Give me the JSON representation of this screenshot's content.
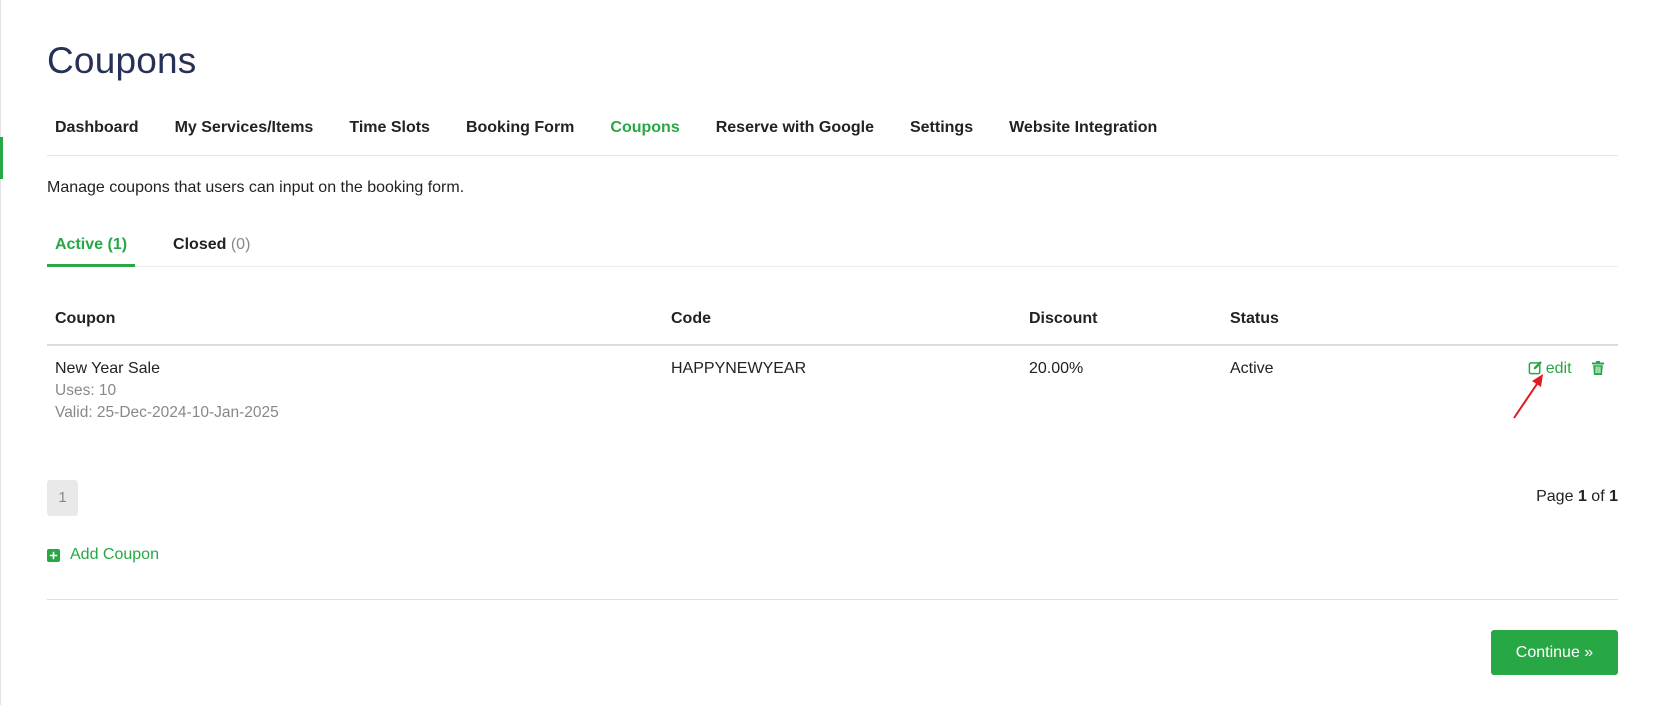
{
  "page": {
    "title": "Coupons"
  },
  "nav": {
    "items": [
      {
        "label": "Dashboard",
        "active": false
      },
      {
        "label": "My Services/Items",
        "active": false
      },
      {
        "label": "Time Slots",
        "active": false
      },
      {
        "label": "Booking Form",
        "active": false
      },
      {
        "label": "Coupons",
        "active": true
      },
      {
        "label": "Reserve with Google",
        "active": false
      },
      {
        "label": "Settings",
        "active": false
      },
      {
        "label": "Website Integration",
        "active": false
      }
    ]
  },
  "description": "Manage coupons that users can input on the booking form.",
  "tabs": [
    {
      "label": "Active",
      "count": "(1)",
      "active": true
    },
    {
      "label": "Closed",
      "count": "(0)",
      "active": false
    }
  ],
  "table": {
    "headers": {
      "coupon": "Coupon",
      "code": "Code",
      "discount": "Discount",
      "status": "Status"
    },
    "rows": [
      {
        "name": "New Year Sale",
        "uses": "Uses: 10",
        "valid": "Valid: 25-Dec-2024-10-Jan-2025",
        "code": "HAPPYNEWYEAR",
        "discount": "20.00%",
        "status": "Active",
        "edit_label": "edit"
      }
    ]
  },
  "pagination": {
    "current_page_button": "1",
    "label_page": "Page",
    "current": "1",
    "label_of": "of",
    "total": "1"
  },
  "add_coupon_label": "Add Coupon",
  "continue_label": "Continue »",
  "colors": {
    "accent": "#28a745",
    "title": "#273158",
    "annotation": "#e01b24"
  },
  "icons": {
    "edit": "edit-icon",
    "delete": "trash-icon",
    "add": "plus-square-icon",
    "annotation": "red-arrow-icon"
  }
}
